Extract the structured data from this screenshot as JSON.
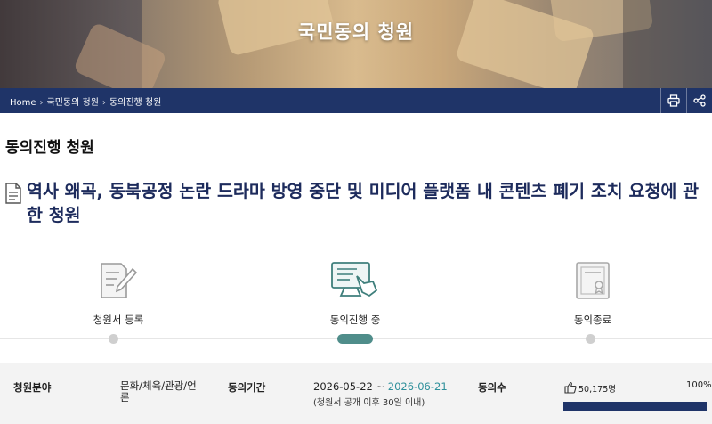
{
  "hero": {
    "title": "국민동의 청원"
  },
  "breadcrumb": {
    "items": [
      "Home",
      "국민동의 청원",
      "동의진행 청원"
    ],
    "separator": "›"
  },
  "actions": {
    "print_icon": "print-icon",
    "share_icon": "share-icon"
  },
  "section": {
    "title": "동의진행 청원"
  },
  "petition": {
    "title": "역사 왜곡, 동북공정 논란 드라마 방영 중단 및 미디어 플랫폼 내 콘텐츠 폐기 조치 요청에 관한 청원"
  },
  "steps": [
    {
      "label": "청원서 등록",
      "icon": "document-pen-icon",
      "active": false
    },
    {
      "label": "동의진행 중",
      "icon": "computer-hand-icon",
      "active": true
    },
    {
      "label": "동의종료",
      "icon": "certificate-icon",
      "active": false
    }
  ],
  "info": {
    "field_label": "청원분야",
    "field_value": "문화/체육/관광/언론",
    "period_label": "동의기간",
    "period_start": "2026-05-22",
    "period_tilde": "~",
    "period_end": "2026-06-21",
    "period_note": "(청원서 공개 이후 30일 이내)",
    "count_label": "동의수",
    "count_value": "50,175명",
    "percent": "100%",
    "progress_fraction": 1.0
  },
  "colors": {
    "navy": "#1f3468",
    "title_navy": "#1d2b5c",
    "teal": "#4f8d8a",
    "period_end": "#2d8f9a"
  }
}
